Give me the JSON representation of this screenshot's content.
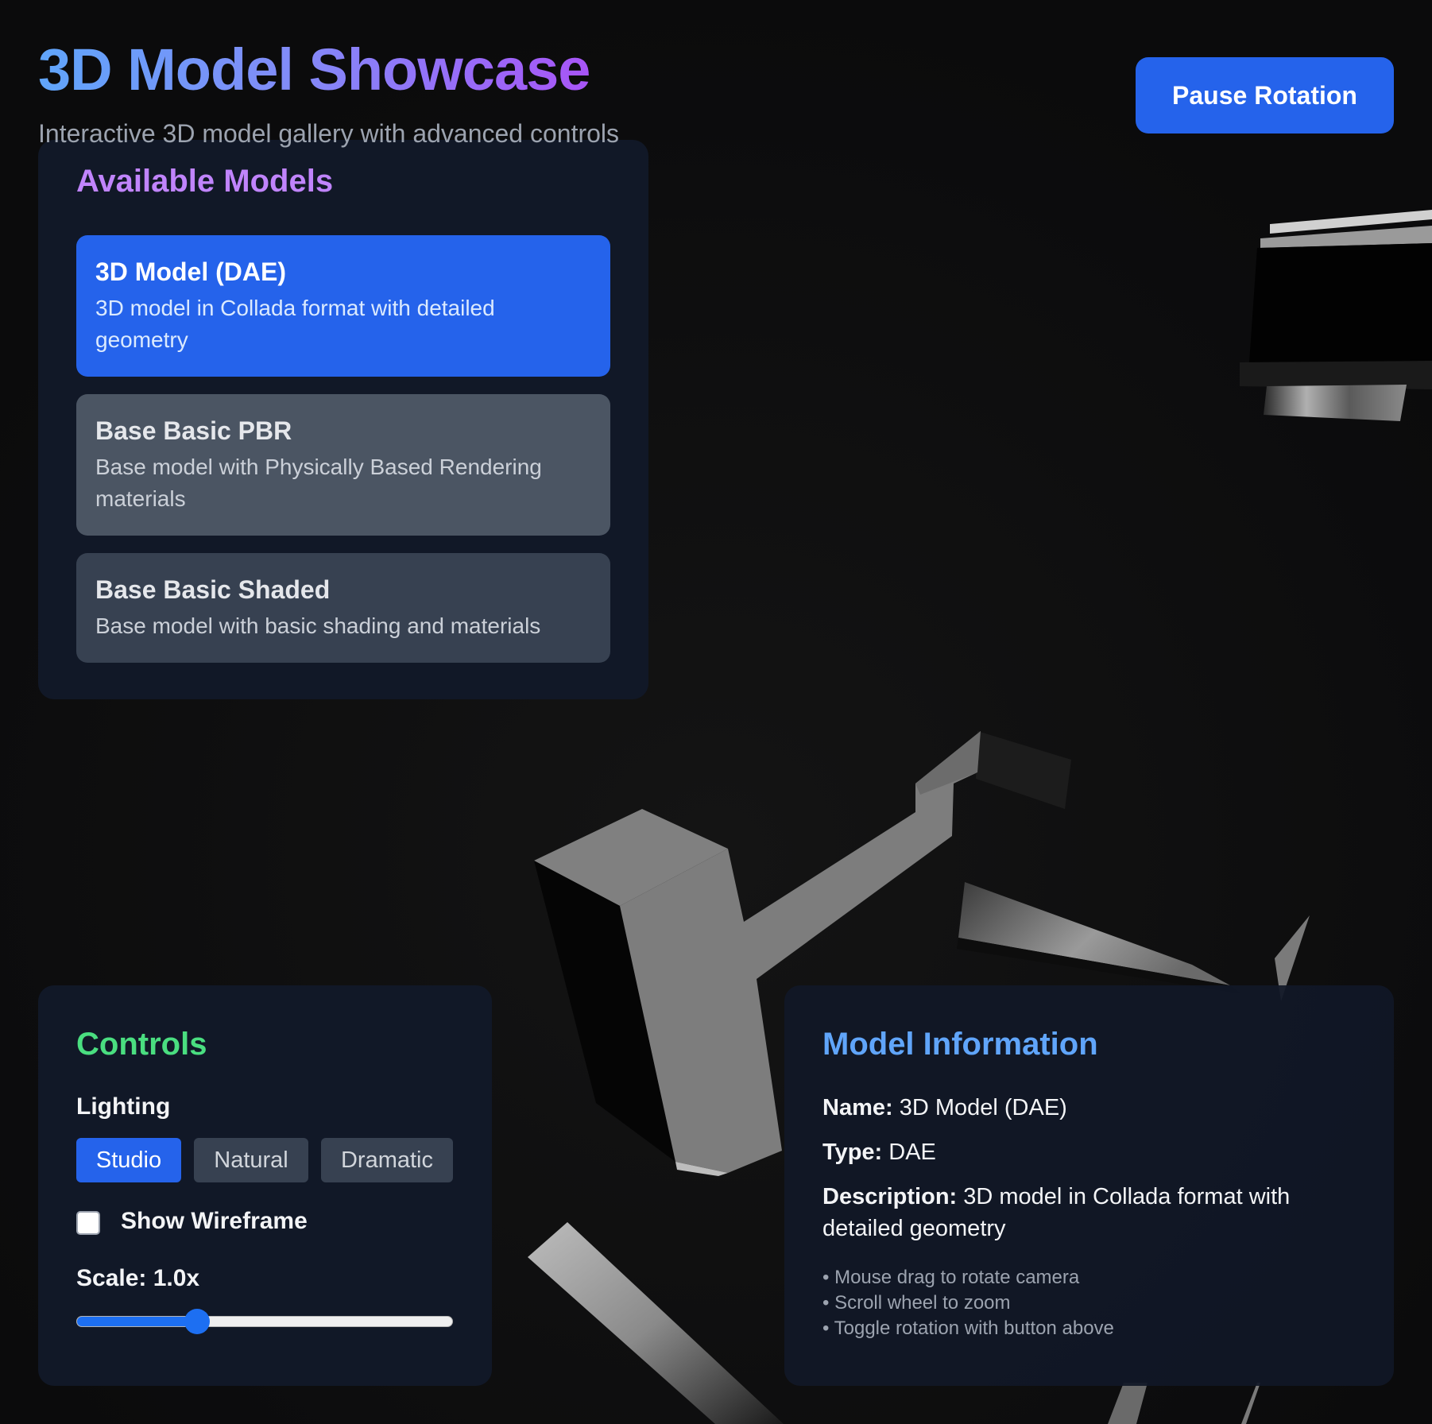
{
  "header": {
    "title": "3D Model Showcase",
    "subtitle": "Interactive 3D model gallery with advanced controls",
    "pause_button_label": "Pause Rotation"
  },
  "models": {
    "heading": "Available Models",
    "selected_index": 0,
    "items": [
      {
        "title": "3D Model (DAE)",
        "description": "3D model in Collada format with detailed geometry"
      },
      {
        "title": "Base Basic PBR",
        "description": "Base model with Physically Based Rendering materials"
      },
      {
        "title": "Base Basic Shaded",
        "description": "Base model with basic shading and materials"
      }
    ]
  },
  "controls": {
    "heading": "Controls",
    "lighting_label": "Lighting",
    "lighting_options": [
      "Studio",
      "Natural",
      "Dramatic"
    ],
    "lighting_selected": "Studio",
    "wireframe_label": "Show Wireframe",
    "wireframe_checked": false,
    "scale_label": "Scale: 1.0x",
    "scale_slider_fraction": 0.32
  },
  "info": {
    "heading": "Model Information",
    "name_label": "Name:",
    "name_value": "3D Model (DAE)",
    "type_label": "Type:",
    "type_value": "DAE",
    "description_label": "Description:",
    "description_value": "3D model in Collada format with detailed geometry",
    "help": [
      "Mouse drag to rotate camera",
      "Scroll wheel to zoom",
      "Toggle rotation with button above"
    ]
  },
  "colors": {
    "accent": "#2563eb",
    "background": "#0b0b0c",
    "panel": "#111827",
    "models_heading": "#c084fc",
    "controls_heading": "#4ade80",
    "info_heading": "#60a5fa"
  }
}
